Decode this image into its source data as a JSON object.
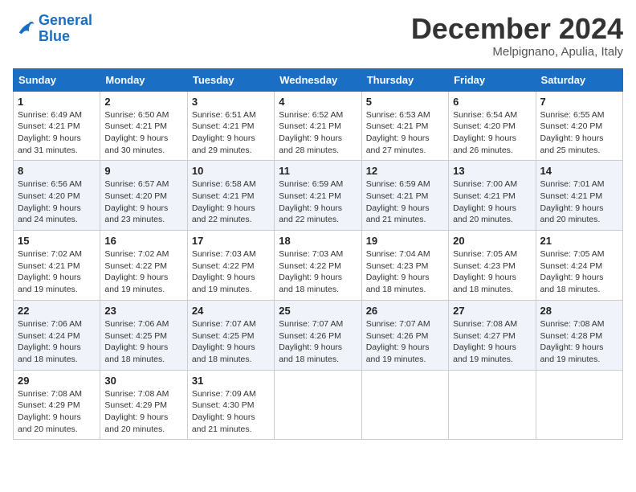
{
  "header": {
    "logo_line1": "General",
    "logo_line2": "Blue",
    "month_title": "December 2024",
    "location": "Melpignano, Apulia, Italy"
  },
  "weekdays": [
    "Sunday",
    "Monday",
    "Tuesday",
    "Wednesday",
    "Thursday",
    "Friday",
    "Saturday"
  ],
  "weeks": [
    [
      {
        "day": "1",
        "info": "Sunrise: 6:49 AM\nSunset: 4:21 PM\nDaylight: 9 hours\nand 31 minutes."
      },
      {
        "day": "2",
        "info": "Sunrise: 6:50 AM\nSunset: 4:21 PM\nDaylight: 9 hours\nand 30 minutes."
      },
      {
        "day": "3",
        "info": "Sunrise: 6:51 AM\nSunset: 4:21 PM\nDaylight: 9 hours\nand 29 minutes."
      },
      {
        "day": "4",
        "info": "Sunrise: 6:52 AM\nSunset: 4:21 PM\nDaylight: 9 hours\nand 28 minutes."
      },
      {
        "day": "5",
        "info": "Sunrise: 6:53 AM\nSunset: 4:21 PM\nDaylight: 9 hours\nand 27 minutes."
      },
      {
        "day": "6",
        "info": "Sunrise: 6:54 AM\nSunset: 4:20 PM\nDaylight: 9 hours\nand 26 minutes."
      },
      {
        "day": "7",
        "info": "Sunrise: 6:55 AM\nSunset: 4:20 PM\nDaylight: 9 hours\nand 25 minutes."
      }
    ],
    [
      {
        "day": "8",
        "info": "Sunrise: 6:56 AM\nSunset: 4:20 PM\nDaylight: 9 hours\nand 24 minutes."
      },
      {
        "day": "9",
        "info": "Sunrise: 6:57 AM\nSunset: 4:20 PM\nDaylight: 9 hours\nand 23 minutes."
      },
      {
        "day": "10",
        "info": "Sunrise: 6:58 AM\nSunset: 4:21 PM\nDaylight: 9 hours\nand 22 minutes."
      },
      {
        "day": "11",
        "info": "Sunrise: 6:59 AM\nSunset: 4:21 PM\nDaylight: 9 hours\nand 22 minutes."
      },
      {
        "day": "12",
        "info": "Sunrise: 6:59 AM\nSunset: 4:21 PM\nDaylight: 9 hours\nand 21 minutes."
      },
      {
        "day": "13",
        "info": "Sunrise: 7:00 AM\nSunset: 4:21 PM\nDaylight: 9 hours\nand 20 minutes."
      },
      {
        "day": "14",
        "info": "Sunrise: 7:01 AM\nSunset: 4:21 PM\nDaylight: 9 hours\nand 20 minutes."
      }
    ],
    [
      {
        "day": "15",
        "info": "Sunrise: 7:02 AM\nSunset: 4:21 PM\nDaylight: 9 hours\nand 19 minutes."
      },
      {
        "day": "16",
        "info": "Sunrise: 7:02 AM\nSunset: 4:22 PM\nDaylight: 9 hours\nand 19 minutes."
      },
      {
        "day": "17",
        "info": "Sunrise: 7:03 AM\nSunset: 4:22 PM\nDaylight: 9 hours\nand 19 minutes."
      },
      {
        "day": "18",
        "info": "Sunrise: 7:03 AM\nSunset: 4:22 PM\nDaylight: 9 hours\nand 18 minutes."
      },
      {
        "day": "19",
        "info": "Sunrise: 7:04 AM\nSunset: 4:23 PM\nDaylight: 9 hours\nand 18 minutes."
      },
      {
        "day": "20",
        "info": "Sunrise: 7:05 AM\nSunset: 4:23 PM\nDaylight: 9 hours\nand 18 minutes."
      },
      {
        "day": "21",
        "info": "Sunrise: 7:05 AM\nSunset: 4:24 PM\nDaylight: 9 hours\nand 18 minutes."
      }
    ],
    [
      {
        "day": "22",
        "info": "Sunrise: 7:06 AM\nSunset: 4:24 PM\nDaylight: 9 hours\nand 18 minutes."
      },
      {
        "day": "23",
        "info": "Sunrise: 7:06 AM\nSunset: 4:25 PM\nDaylight: 9 hours\nand 18 minutes."
      },
      {
        "day": "24",
        "info": "Sunrise: 7:07 AM\nSunset: 4:25 PM\nDaylight: 9 hours\nand 18 minutes."
      },
      {
        "day": "25",
        "info": "Sunrise: 7:07 AM\nSunset: 4:26 PM\nDaylight: 9 hours\nand 18 minutes."
      },
      {
        "day": "26",
        "info": "Sunrise: 7:07 AM\nSunset: 4:26 PM\nDaylight: 9 hours\nand 19 minutes."
      },
      {
        "day": "27",
        "info": "Sunrise: 7:08 AM\nSunset: 4:27 PM\nDaylight: 9 hours\nand 19 minutes."
      },
      {
        "day": "28",
        "info": "Sunrise: 7:08 AM\nSunset: 4:28 PM\nDaylight: 9 hours\nand 19 minutes."
      }
    ],
    [
      {
        "day": "29",
        "info": "Sunrise: 7:08 AM\nSunset: 4:29 PM\nDaylight: 9 hours\nand 20 minutes."
      },
      {
        "day": "30",
        "info": "Sunrise: 7:08 AM\nSunset: 4:29 PM\nDaylight: 9 hours\nand 20 minutes."
      },
      {
        "day": "31",
        "info": "Sunrise: 7:09 AM\nSunset: 4:30 PM\nDaylight: 9 hours\nand 21 minutes."
      },
      null,
      null,
      null,
      null
    ]
  ]
}
